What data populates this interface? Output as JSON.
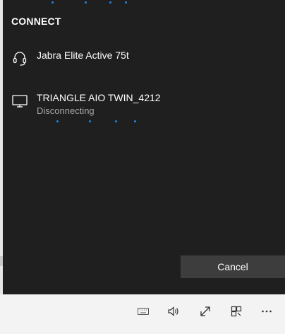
{
  "panel": {
    "title": "CONNECT",
    "cancel_label": "Cancel"
  },
  "devices": [
    {
      "name": "Jabra Elite Active 75t",
      "status": "",
      "icon": "headset-icon"
    },
    {
      "name": "TRIANGLE AIO TWIN_4212",
      "status": "Disconnecting",
      "icon": "monitor-icon"
    }
  ],
  "colors": {
    "panel_bg": "#1f1f1f",
    "accent": "#1e88e5",
    "button_bg": "#3d3d3d",
    "secondary_text": "#a8a8a8"
  },
  "taskbar": {
    "icons": [
      "keyboard-icon",
      "volume-icon",
      "fullscreen-icon",
      "snap-icon",
      "more-options-icon"
    ]
  }
}
